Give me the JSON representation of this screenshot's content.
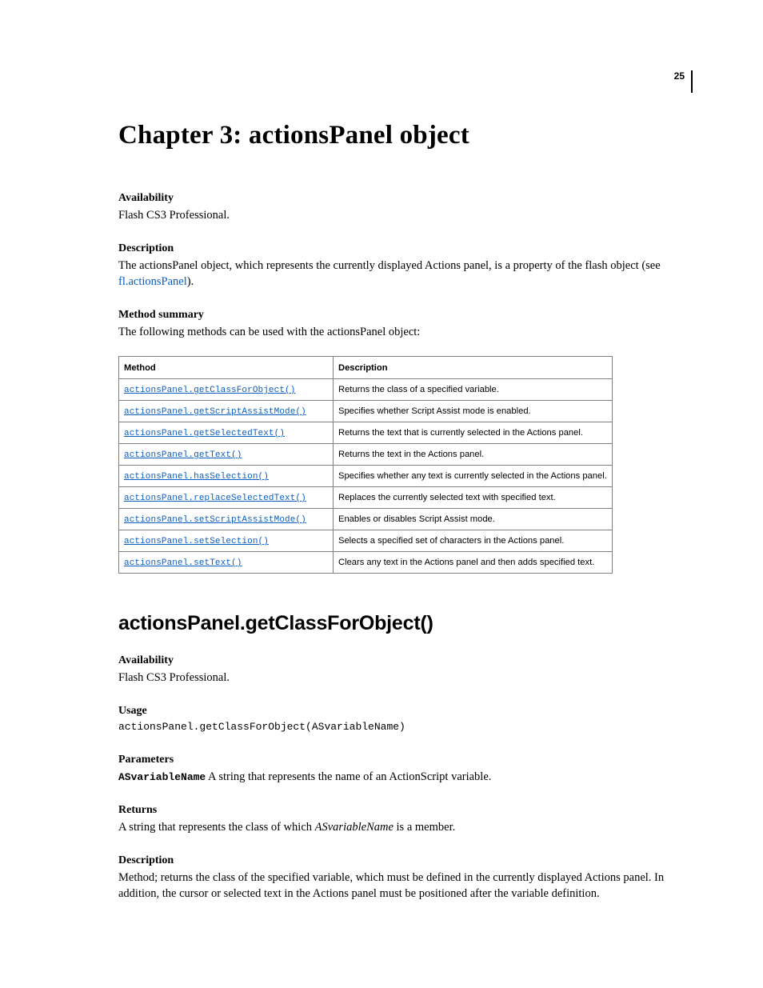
{
  "page_number": "25",
  "chapter_title": "Chapter 3: actionsPanel object",
  "s1": {
    "availability": {
      "label": "Availability",
      "text": "Flash CS3 Professional."
    },
    "description": {
      "label": "Description",
      "text_a": "The actionsPanel object, which represents the currently displayed Actions panel, is a property of the flash object (see ",
      "link": "fl.actionsPanel",
      "text_b": ")."
    },
    "method_summary": {
      "label": "Method summary",
      "intro": "The following methods can be used with the actionsPanel object:"
    }
  },
  "table": {
    "headers": {
      "method": "Method",
      "description": "Description"
    },
    "rows": [
      {
        "method": "actionsPanel.getClassForObject()",
        "desc": "Returns the class of a specified variable."
      },
      {
        "method": "actionsPanel.getScriptAssistMode()",
        "desc": "Specifies whether Script Assist mode is enabled."
      },
      {
        "method": "actionsPanel.getSelectedText()",
        "desc": "Returns the text that is currently selected in the Actions panel."
      },
      {
        "method": "actionsPanel.getText()",
        "desc": "Returns the text in the Actions panel."
      },
      {
        "method": "actionsPanel.hasSelection()",
        "desc": "Specifies whether any text is currently selected in the Actions panel."
      },
      {
        "method": "actionsPanel.replaceSelectedText()",
        "desc": "Replaces the currently selected text with specified text."
      },
      {
        "method": "actionsPanel.setScriptAssistMode()",
        "desc": "Enables or disables Script Assist mode."
      },
      {
        "method": "actionsPanel.setSelection()",
        "desc": "Selects a specified set of characters in the Actions panel."
      },
      {
        "method": "actionsPanel.setText()",
        "desc": "Clears any text in the Actions panel and then adds specified text."
      }
    ]
  },
  "method_detail": {
    "heading": "actionsPanel.getClassForObject()",
    "availability": {
      "label": "Availability",
      "text": "Flash CS3 Professional."
    },
    "usage": {
      "label": "Usage",
      "code": "actionsPanel.getClassForObject(ASvariableName)"
    },
    "parameters": {
      "label": "Parameters",
      "name": "ASvariableName",
      "desc": "  A string that represents the name of an ActionScript variable."
    },
    "returns": {
      "label": "Returns",
      "text_a": "A string that represents the class of which ",
      "italic": "ASvariableName",
      "text_b": " is a member."
    },
    "description": {
      "label": "Description",
      "text": "Method; returns the class of the specified variable, which must be defined in the currently displayed Actions panel. In addition, the cursor or selected text in the Actions panel must be positioned after the variable definition."
    }
  }
}
